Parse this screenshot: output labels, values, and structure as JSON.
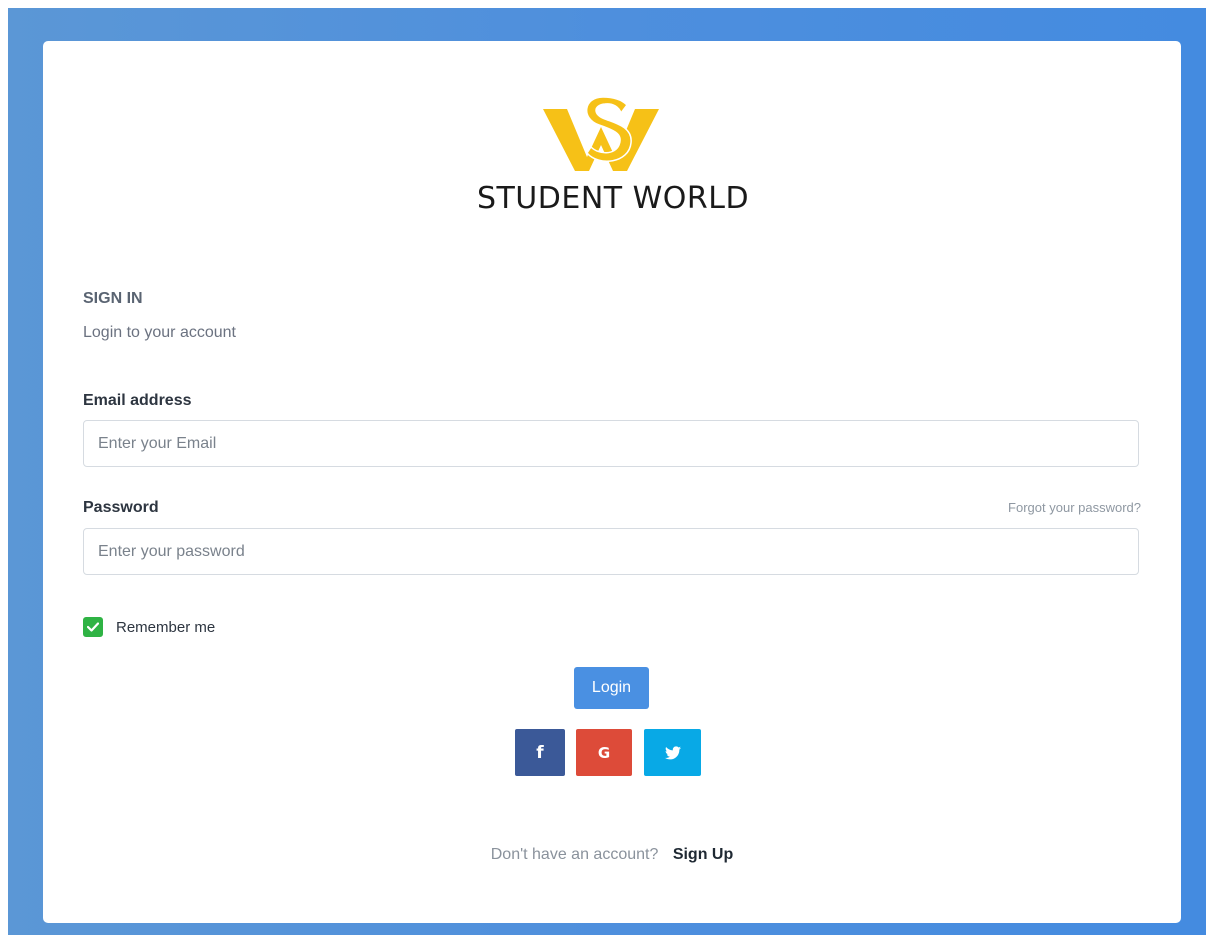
{
  "brand": {
    "name": "STUDENT WORLD",
    "logo_icon": "sw-monogram-icon",
    "logo_color": "#f6c117"
  },
  "signin": {
    "title": "SIGN IN",
    "subtitle": "Login to your account"
  },
  "form": {
    "email": {
      "label": "Email address",
      "placeholder": "Enter your Email",
      "value": ""
    },
    "password": {
      "label": "Password",
      "placeholder": "Enter your password",
      "value": "",
      "forgot_label": "Forgot your password?"
    },
    "remember": {
      "label": "Remember me",
      "checked": true
    },
    "login_label": "Login"
  },
  "social": [
    {
      "name": "facebook",
      "icon": "facebook-icon",
      "glyph": "f",
      "color": "#3b5998"
    },
    {
      "name": "google",
      "icon": "google-icon",
      "glyph": "G",
      "color": "#dd4b39"
    },
    {
      "name": "twitter",
      "icon": "twitter-icon",
      "glyph": "",
      "color": "#08a9e6"
    }
  ],
  "footer": {
    "prompt": "Don't have an account?",
    "signup_label": "Sign Up"
  },
  "colors": {
    "background_gradient": [
      "#5b97d6",
      "#448be0"
    ],
    "accent": "#4a90e2",
    "checkbox": "#2fb344"
  }
}
